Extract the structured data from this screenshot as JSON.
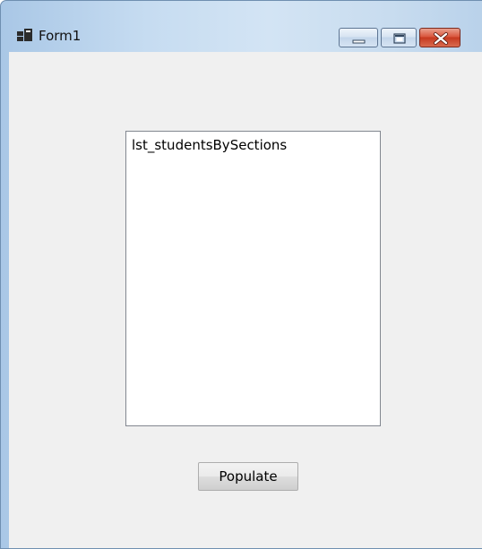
{
  "window": {
    "title": "Form1",
    "app_icon": "form-icon",
    "controls": {
      "minimize": "minimize-icon",
      "maximize": "maximize-icon",
      "close": "close-icon"
    }
  },
  "form": {
    "listbox": {
      "items": [
        "lst_studentsBySections"
      ]
    },
    "populate_button": {
      "label": "Populate"
    }
  },
  "colors": {
    "client_background": "#f0f0f0",
    "listbox_border": "#828790",
    "close_button": "#c6391f",
    "titlebar": "#c6dcf1"
  }
}
